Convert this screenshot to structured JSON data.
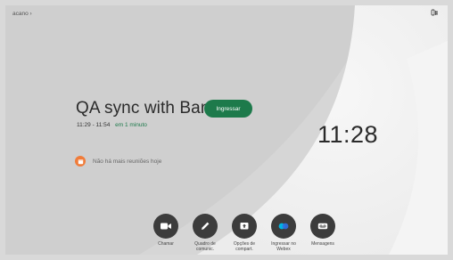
{
  "header": {
    "device_name": "acano",
    "device_chevron": "›",
    "top_right_icon": "headset-icon"
  },
  "meeting": {
    "title": "QA sync with Ban…",
    "time_range": "11:29 - 11:54",
    "relative": "em 1 minuto",
    "join_label": "Ingressar"
  },
  "clock": {
    "time": "11:28"
  },
  "notice": {
    "text": "Não há mais reuniões hoje",
    "icon": "calendar-icon"
  },
  "dock": {
    "items": [
      {
        "label": "Chamar",
        "icon": "video-camera-icon"
      },
      {
        "label": "Quadro de\ncomunic.",
        "icon": "pencil-icon"
      },
      {
        "label": "Opções de\ncompart.",
        "icon": "share-screen-icon"
      },
      {
        "label": "Ingressar no\nWebex",
        "icon": "webex-icon"
      },
      {
        "label": "Mensagens",
        "icon": "voicemail-icon"
      }
    ]
  },
  "colors": {
    "accent_green": "#1d7a4b",
    "notice_orange": "#f07c3a",
    "dock_button": "#3c3c3c"
  }
}
